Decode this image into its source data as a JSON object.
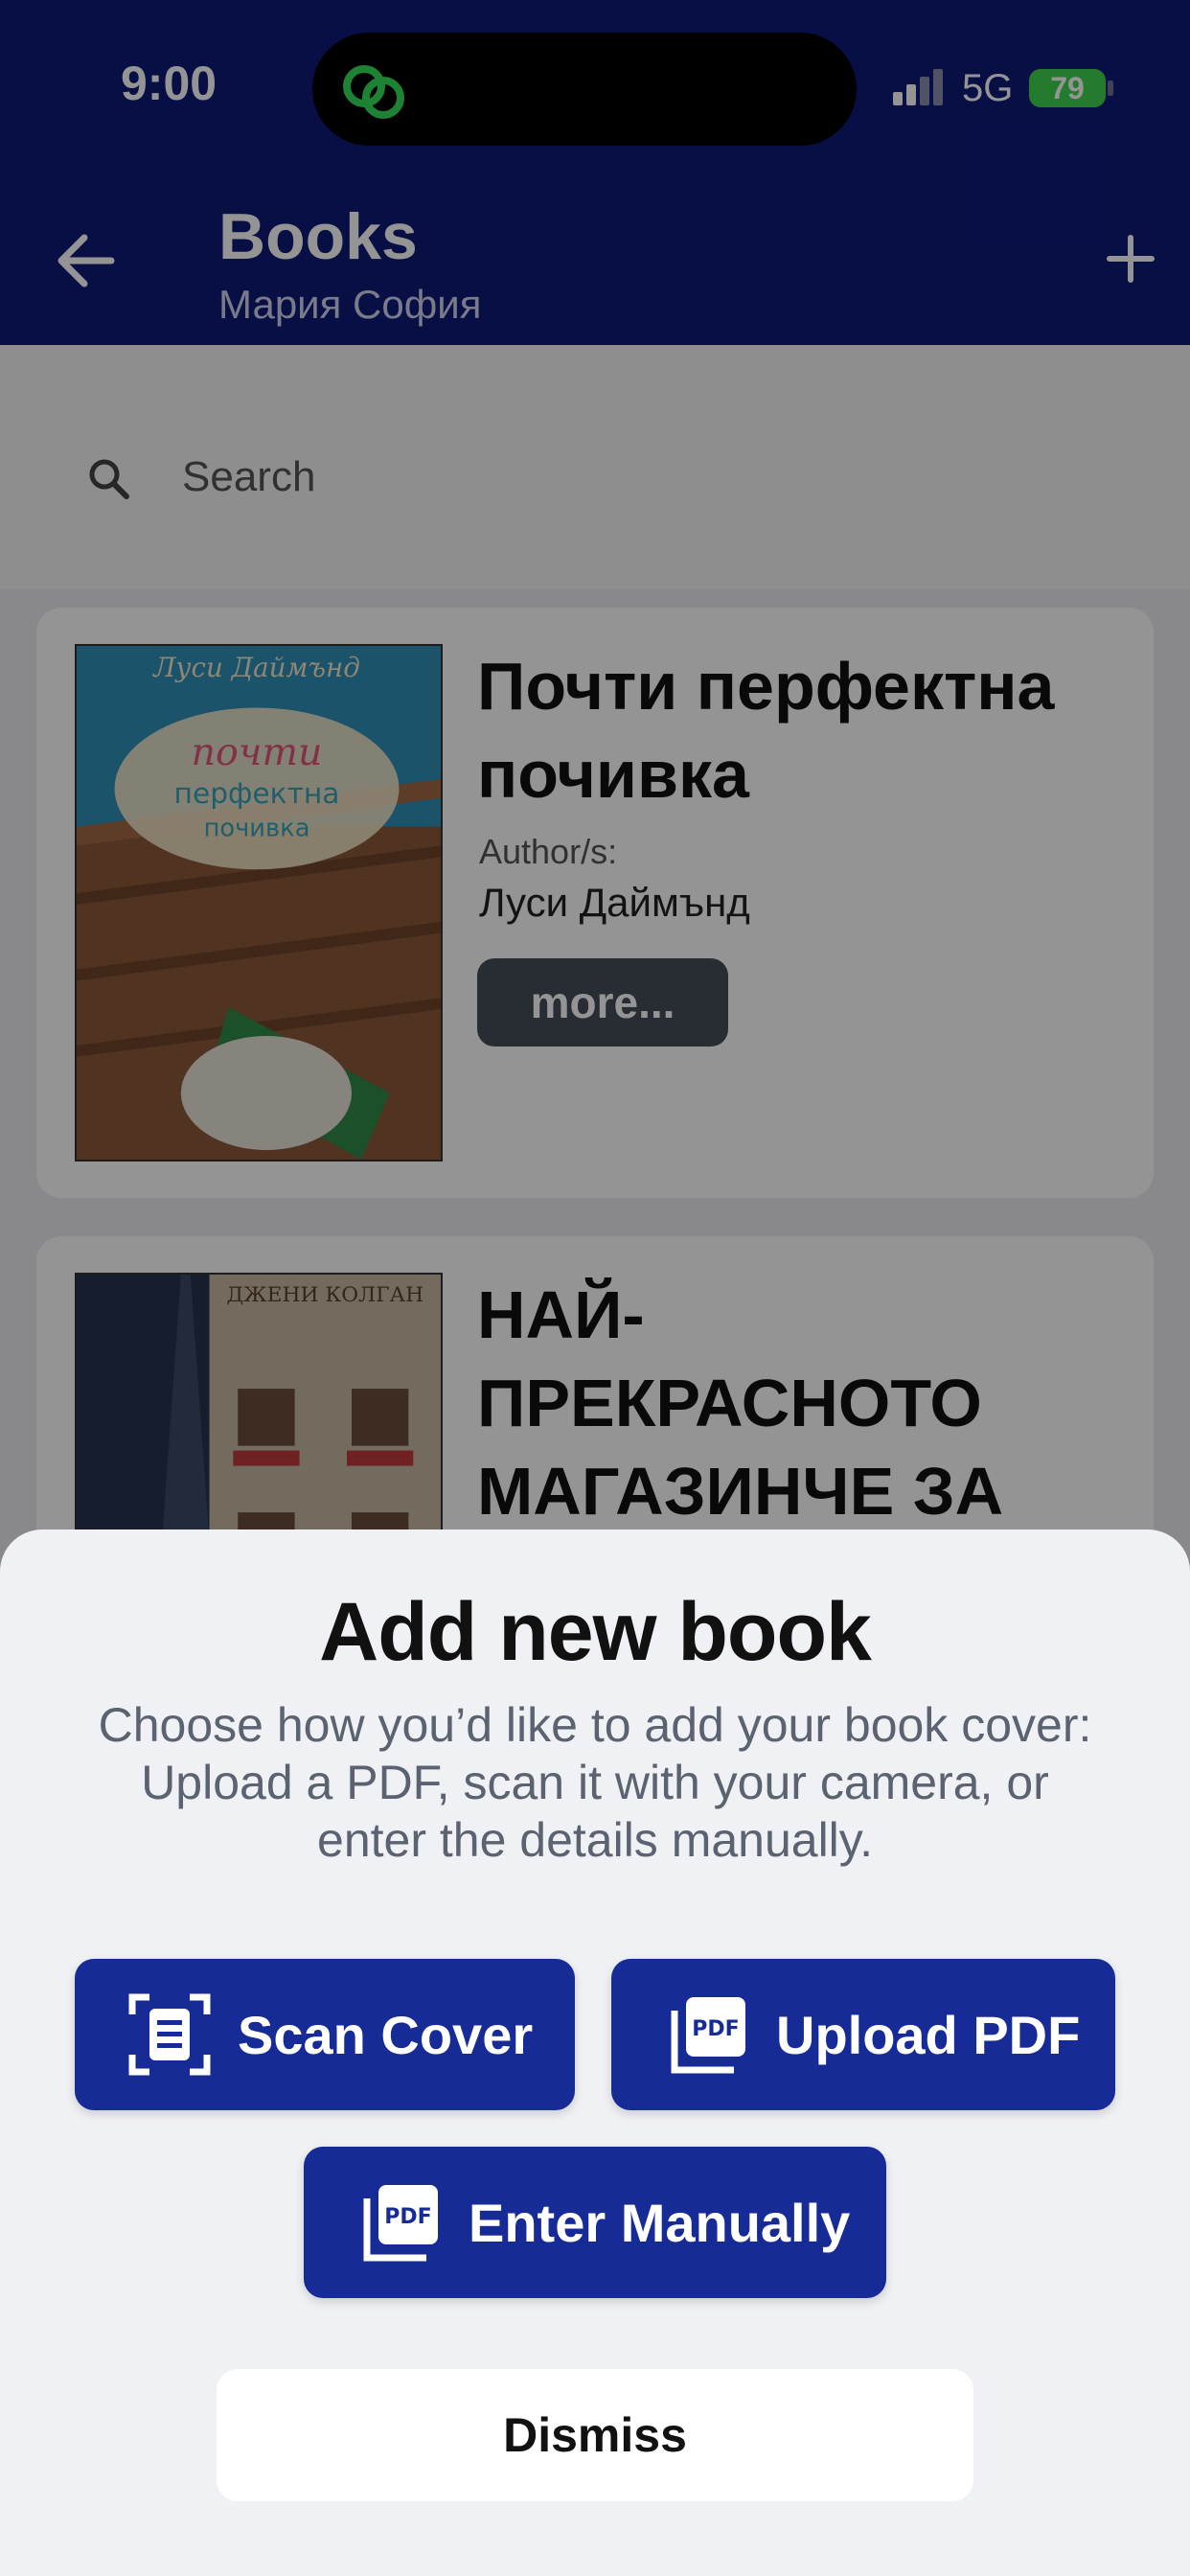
{
  "status_bar": {
    "time": "9:00",
    "network": "5G",
    "battery": "79"
  },
  "header": {
    "title": "Books",
    "subtitle": "Мария София"
  },
  "search": {
    "placeholder": "Search"
  },
  "books": [
    {
      "title": "Почти перфектна почивка",
      "author_label": "Author/s:",
      "author": "Луси Даймънд",
      "more_label": "more...",
      "cover_author": "Луси Даймънд",
      "cover_title_1": "почти",
      "cover_title_2": "перфектна",
      "cover_title_3": "почивка"
    },
    {
      "title": "НАЙ-ПРЕКРАСНОТО МАГАЗИНЧЕ ЗА",
      "cover_author": "ДЖЕНИ КОЛГАН"
    }
  ],
  "sheet": {
    "title": "Add new book",
    "description": "Choose how you’d like to add your book cover:\nUpload a PDF, scan it with your camera, or enter the details manually.",
    "scan_label": "Scan Cover",
    "upload_label": "Upload PDF",
    "manual_label": "Enter Manually",
    "pdf_icon_text": "PDF",
    "dismiss_label": "Dismiss"
  },
  "colors": {
    "header_bg": "#0d1a78",
    "action_button": "#172b97",
    "battery": "#3fd24f"
  }
}
